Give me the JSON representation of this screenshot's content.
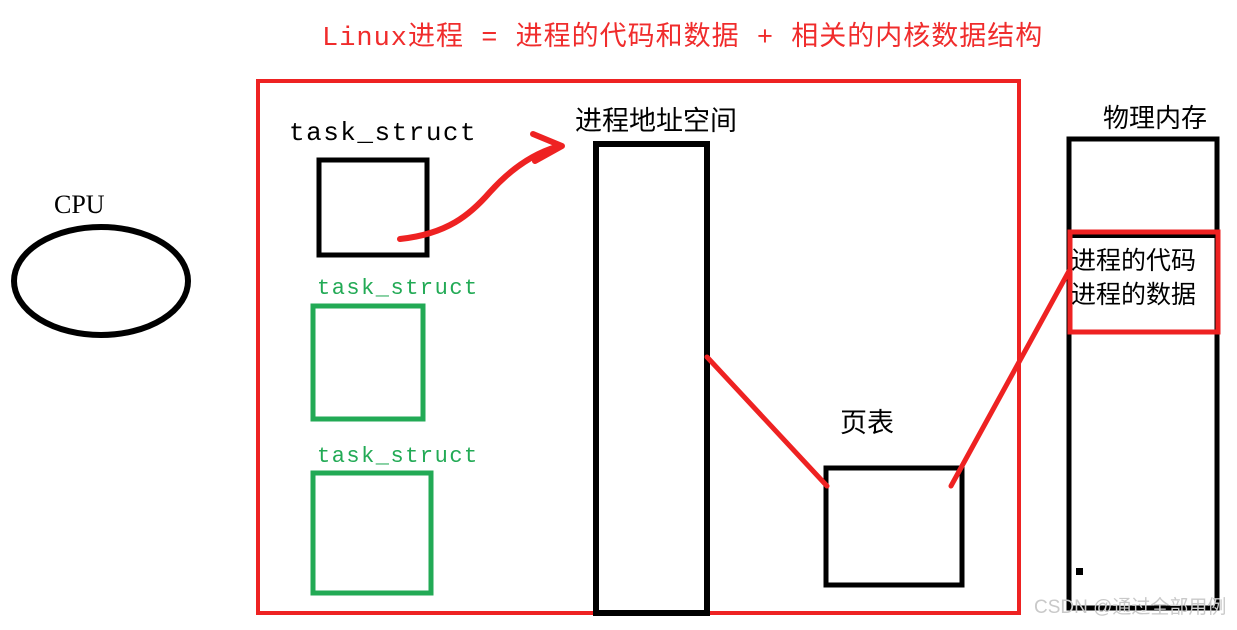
{
  "diagram": {
    "title": "Linux进程 = 进程的代码和数据 + 相关的内核数据结构",
    "title_color": "#f02c2c",
    "accent_red": "#ee2222",
    "accent_green": "#22aa55",
    "accent_black": "#000000"
  },
  "cpu": {
    "label": "CPU"
  },
  "task_structs": [
    {
      "label": "task_struct",
      "color": "#000000"
    },
    {
      "label": "task_struct",
      "color": "#22aa55"
    },
    {
      "label": "task_struct",
      "color": "#22aa55"
    }
  ],
  "address_space": {
    "label": "进程地址空间"
  },
  "page_table": {
    "label": "页表"
  },
  "physical_memory": {
    "label": "物理内存",
    "cell_lines": [
      "进程的代码",
      "进程的数据"
    ],
    "highlight_color": "#ee2222"
  },
  "watermark": {
    "text": "CSDN @通过全部用例"
  }
}
